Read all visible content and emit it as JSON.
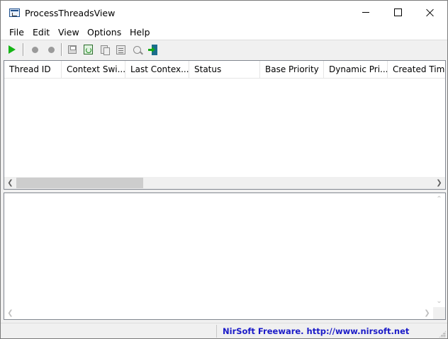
{
  "window": {
    "title": "ProcessThreadsView"
  },
  "menu": [
    "File",
    "Edit",
    "View",
    "Options",
    "Help"
  ],
  "toolbar": {
    "icons": [
      "play-icon",
      "stop-icon",
      "pause-icon",
      "save-icon",
      "refresh-icon",
      "copy-icon",
      "properties-icon",
      "find-icon",
      "exit-icon"
    ]
  },
  "table": {
    "columns": [
      "Thread ID",
      "Context Swi...",
      "Last Contex...",
      "Status",
      "Base Priority",
      "Dynamic Pri...",
      "Created Time"
    ],
    "rows": []
  },
  "status": {
    "text": "NirSoft Freeware.  http://www.nirsoft.net"
  },
  "colors": {
    "link": "#1a1ac8",
    "play": "#16b516"
  }
}
